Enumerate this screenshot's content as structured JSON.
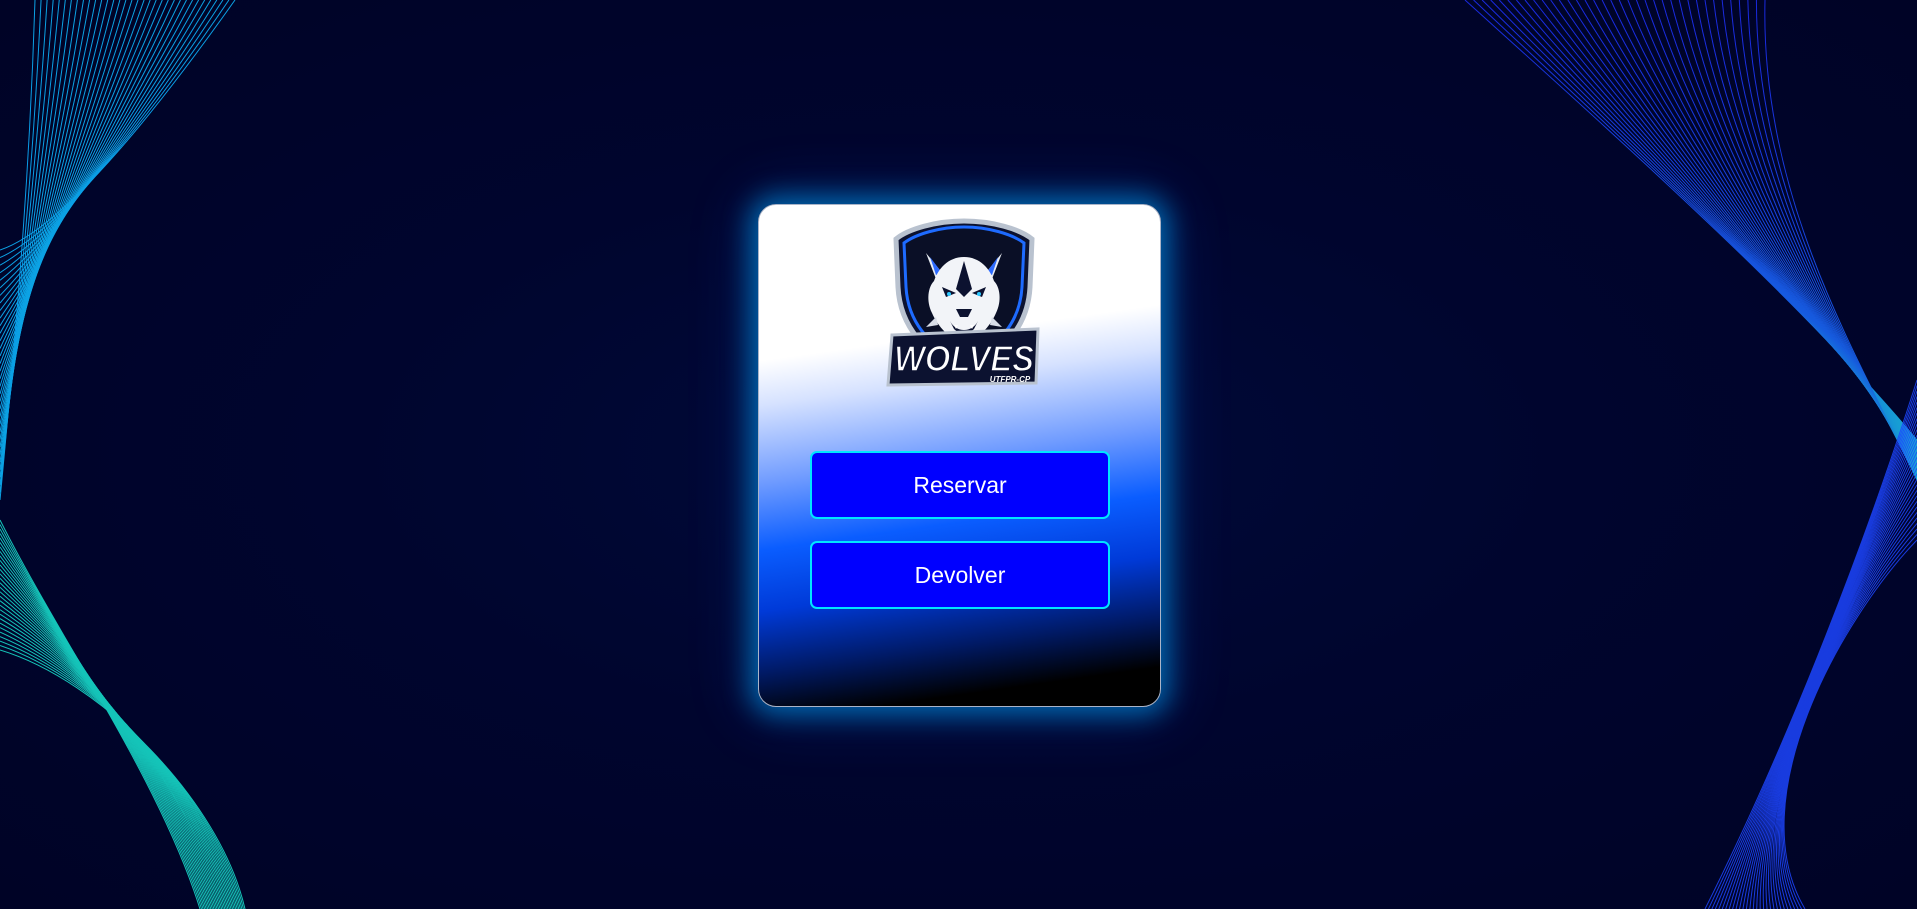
{
  "logo": {
    "name": "WOLVES",
    "subtitle": "UTFPR-CP"
  },
  "actions": {
    "reservar_label": "Reservar",
    "devolver_label": "Devolver"
  },
  "colors": {
    "background": "#00052e",
    "button": "#0000ff",
    "button_border": "#00e5ff",
    "glow": "#00aaff",
    "line_teal": "#19e6d2",
    "line_blue": "#1e46ff"
  }
}
